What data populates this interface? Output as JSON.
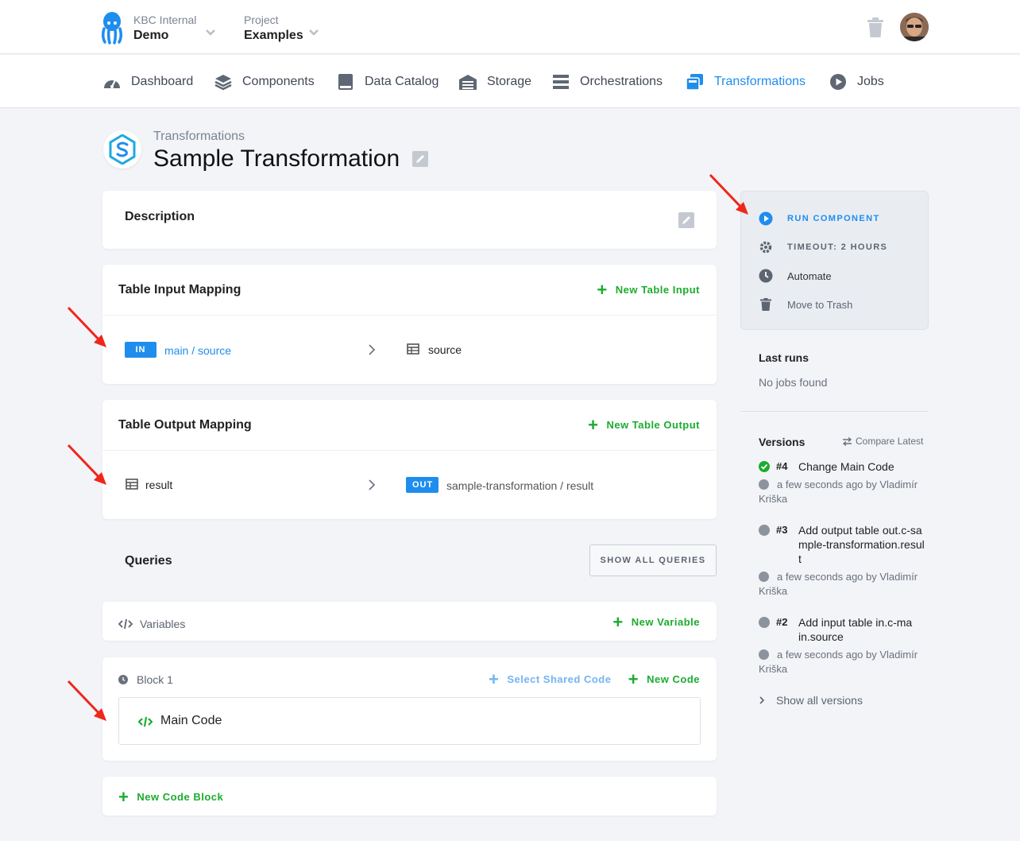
{
  "topbar": {
    "org_label": "KBC Internal",
    "org_name": "Demo",
    "project_label": "Project",
    "project_name": "Examples"
  },
  "nav": {
    "items": [
      {
        "label": "Dashboard",
        "icon": "dashboard-icon"
      },
      {
        "label": "Components",
        "icon": "layers-icon"
      },
      {
        "label": "Data Catalog",
        "icon": "book-icon"
      },
      {
        "label": "Storage",
        "icon": "warehouse-icon"
      },
      {
        "label": "Orchestrations",
        "icon": "bars-icon"
      },
      {
        "label": "Transformations",
        "icon": "transformations-icon",
        "active": true
      },
      {
        "label": "Jobs",
        "icon": "play-circle-icon"
      }
    ]
  },
  "header": {
    "breadcrumb": "Transformations",
    "title": "Sample Transformation"
  },
  "description": {
    "title": "Description"
  },
  "input_mapping": {
    "title": "Table Input Mapping",
    "action": "New Table Input",
    "row": {
      "badge": "IN",
      "source": "main / source",
      "destination": "source"
    }
  },
  "output_mapping": {
    "title": "Table Output Mapping",
    "action": "New Table Output",
    "row": {
      "source": "result",
      "badge": "OUT",
      "destination": "sample-transformation / result"
    }
  },
  "queries": {
    "title": "Queries",
    "show_all": "SHOW ALL QUERIES"
  },
  "variables": {
    "label": "Variables",
    "action": "New Variable"
  },
  "block": {
    "label": "Block 1",
    "shared_code": "Select Shared Code",
    "new_code": "New Code",
    "code_name": "Main Code"
  },
  "new_block": "New Code Block",
  "sidebar": {
    "actions": [
      {
        "label": "RUN COMPONENT",
        "icon": "play-circle-icon"
      },
      {
        "label": "TIMEOUT: 2 HOURS",
        "icon": "gear-icon"
      },
      {
        "label": "Automate",
        "icon": "clock-icon"
      },
      {
        "label": "Move to Trash",
        "icon": "trash-icon"
      }
    ],
    "last_runs_title": "Last runs",
    "last_runs_empty": "No jobs found",
    "versions_title": "Versions",
    "compare_latest": "Compare Latest",
    "versions": [
      {
        "num": "#4",
        "title": "Change Main Code",
        "meta": "a few seconds ago by Vladimír Kriška",
        "status": "current"
      },
      {
        "num": "#3",
        "title": "Add output table out.c-sample-transformation.result",
        "meta": "a few seconds ago by Vladimír Kriška",
        "status": "old"
      },
      {
        "num": "#2",
        "title": "Add input table in.c-main.source",
        "meta": "a few seconds ago by Vladimír Kriška",
        "status": "old"
      }
    ],
    "show_all_versions": "Show all versions"
  },
  "colors": {
    "accent": "#1f8ded",
    "green": "#1bac2f",
    "annotation_red": "#f0261b"
  }
}
